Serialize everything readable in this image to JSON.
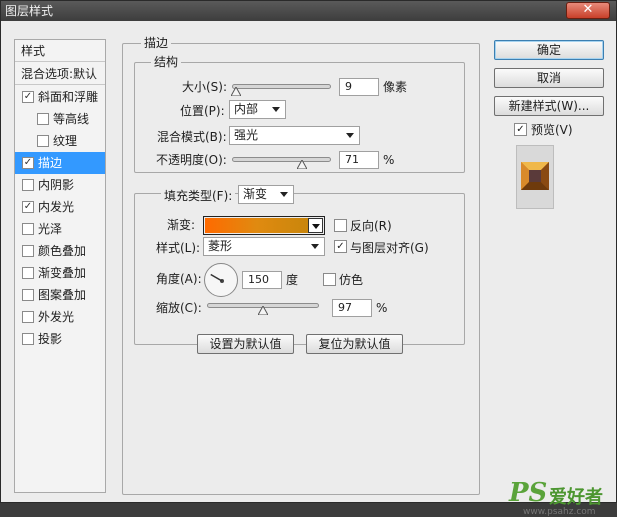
{
  "window": {
    "title": "图层样式",
    "close_glyph": "✕"
  },
  "style_list": {
    "header": "样式",
    "blend_options": "混合选项:默认",
    "items": [
      {
        "label": "斜面和浮雕",
        "checked": true,
        "check": "✓"
      },
      {
        "label": "等高线",
        "checked": false,
        "check": ""
      },
      {
        "label": "纹理",
        "checked": false,
        "check": ""
      },
      {
        "label": "描边",
        "checked": true,
        "check": "✓",
        "selected": true
      },
      {
        "label": "内阴影",
        "checked": false,
        "check": ""
      },
      {
        "label": "内发光",
        "checked": true,
        "check": "✓"
      },
      {
        "label": "光泽",
        "checked": false,
        "check": ""
      },
      {
        "label": "颜色叠加",
        "checked": false,
        "check": ""
      },
      {
        "label": "渐变叠加",
        "checked": false,
        "check": ""
      },
      {
        "label": "图案叠加",
        "checked": false,
        "check": ""
      },
      {
        "label": "外发光",
        "checked": false,
        "check": ""
      },
      {
        "label": "投影",
        "checked": false,
        "check": ""
      }
    ]
  },
  "stroke": {
    "title": "描边",
    "structure": {
      "title": "结构",
      "size_label": "大小(S):",
      "size_value": "9",
      "size_unit": "像素",
      "size_slider": 0.04,
      "position_label": "位置(P):",
      "position_value": "内部",
      "blend_label": "混合模式(B):",
      "blend_value": "强光",
      "opacity_label": "不透明度(O):",
      "opacity_value": "71",
      "opacity_unit": "%",
      "opacity_slider": 0.71
    },
    "fill": {
      "type_label": "填充类型(F):",
      "type_value": "渐变",
      "gradient_label": "渐变:",
      "gradient_colors": [
        "#ff6a00",
        "#e08a10",
        "#c9860c"
      ],
      "reverse_label": "反向(R)",
      "reverse_checked": false,
      "style_label": "样式(L):",
      "style_value": "菱形",
      "align_label": "与图层对齐(G)",
      "align_checked": true,
      "align_check": "✓",
      "angle_label": "角度(A):",
      "angle_value": "150",
      "angle_unit": "度",
      "angle_degrees": 150,
      "dither_label": "仿色",
      "dither_checked": false,
      "scale_label": "缩放(C):",
      "scale_value": "97",
      "scale_unit": "%",
      "scale_slider": 0.5
    },
    "set_default": "设置为默认值",
    "reset_default": "复位为默认值"
  },
  "actions": {
    "ok": "确定",
    "cancel": "取消",
    "new_style": "新建样式(W)...",
    "preview_label": "预览(V)",
    "preview_checked": true,
    "preview_check": "✓"
  },
  "watermark": {
    "logo": "PS",
    "name": "爱好者",
    "url": "www.psahz.com"
  },
  "colors": {
    "selection": "#3399ff",
    "watermark": "#5aa33a"
  }
}
